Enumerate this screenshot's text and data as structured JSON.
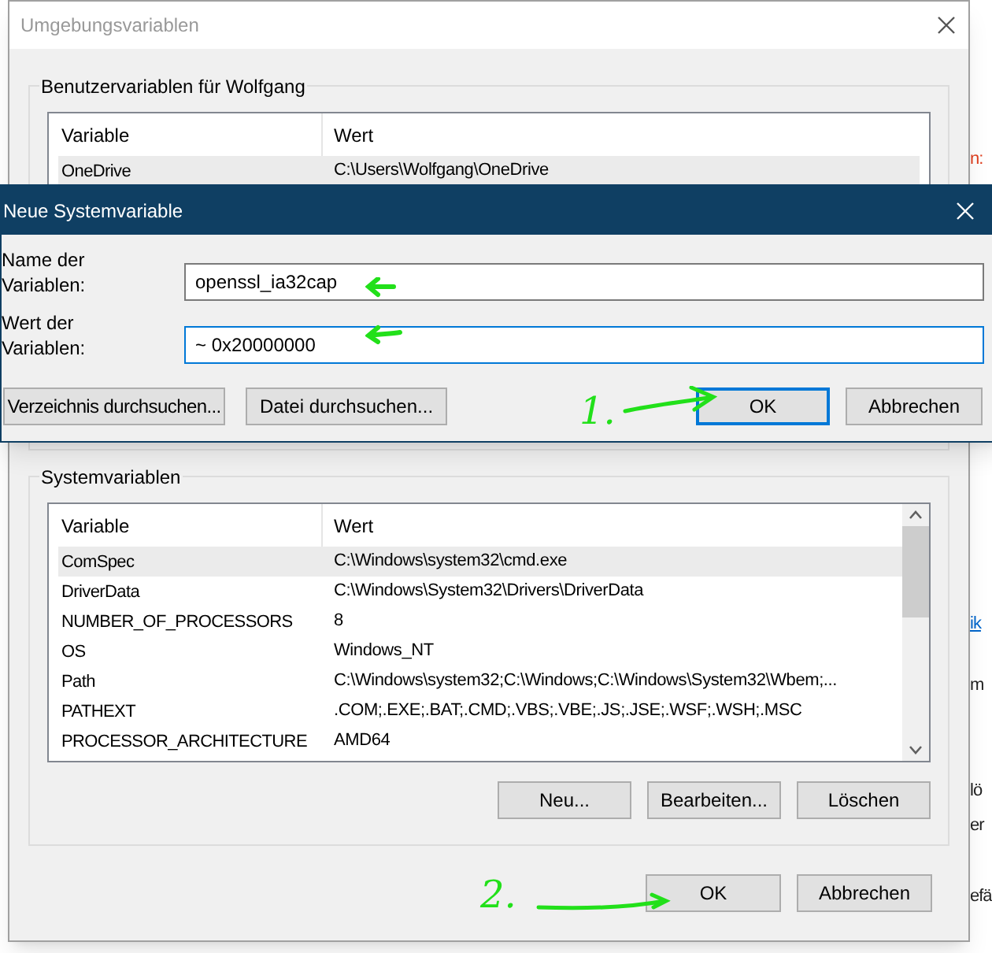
{
  "window": {
    "title": "Umgebungsvariablen"
  },
  "user_variables": {
    "title": "Benutzervariablen für Wolfgang",
    "columns": [
      "Variable",
      "Wert"
    ],
    "rows": [
      {
        "variable": "OneDrive",
        "value": "C:\\Users\\Wolfgang\\OneDrive",
        "selected": true
      }
    ]
  },
  "dialog": {
    "title": "Neue Systemvariable",
    "fields": [
      {
        "label": "Name der Variablen:",
        "value": "openssl_ia32cap",
        "focused": false
      },
      {
        "label": "Wert der Variablen:",
        "value": "~ 0x20000000",
        "focused": true
      }
    ],
    "buttons": [
      {
        "label": "Verzeichnis durchsuchen...",
        "default": false
      },
      {
        "label": "Datei durchsuchen...",
        "default": false
      },
      {
        "label": "OK",
        "default": true
      },
      {
        "label": "Abbrechen",
        "default": false
      }
    ]
  },
  "system_variables": {
    "title": "Systemvariablen",
    "columns": [
      "Variable",
      "Wert"
    ],
    "rows": [
      {
        "variable": "ComSpec",
        "value": "C:\\Windows\\system32\\cmd.exe",
        "selected": true
      },
      {
        "variable": "DriverData",
        "value": "C:\\Windows\\System32\\Drivers\\DriverData",
        "selected": false
      },
      {
        "variable": "NUMBER_OF_PROCESSORS",
        "value": "8",
        "selected": false
      },
      {
        "variable": "OS",
        "value": "Windows_NT",
        "selected": false
      },
      {
        "variable": "Path",
        "value": "C:\\Windows\\system32;C:\\Windows;C:\\Windows\\System32\\Wbem;...",
        "selected": false
      },
      {
        "variable": "PATHEXT",
        "value": ".COM;.EXE;.BAT;.CMD;.VBS;.VBE;.JS;.JSE;.WSF;.WSH;.MSC",
        "selected": false
      },
      {
        "variable": "PROCESSOR_ARCHITECTURE",
        "value": "AMD64",
        "selected": false
      }
    ],
    "buttons": [
      "Neu...",
      "Bearbeiten...",
      "Löschen"
    ]
  },
  "footer_buttons": [
    {
      "label": "OK",
      "default": false
    },
    {
      "label": "Abbrechen",
      "default": false
    }
  ],
  "annotations": [
    {
      "text": "1."
    },
    {
      "text": "2."
    }
  ],
  "background_fragments": [
    {
      "text": "n:",
      "kind": "warning"
    },
    {
      "text": "ik",
      "kind": "link"
    },
    {
      "text": "m",
      "kind": "plain"
    },
    {
      "text": "lö",
      "kind": "plain"
    },
    {
      "text": "er",
      "kind": "plain"
    },
    {
      "text": "efä",
      "kind": "plain"
    }
  ]
}
